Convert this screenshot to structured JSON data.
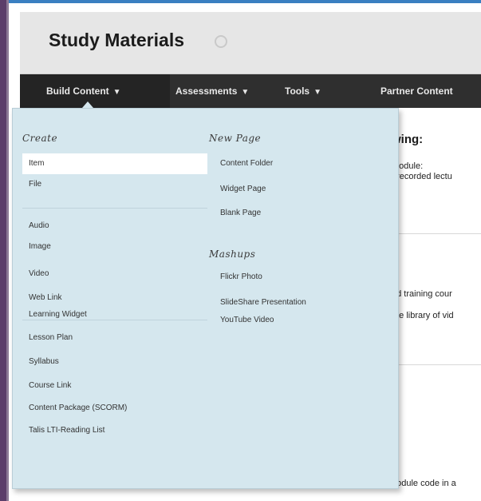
{
  "page": {
    "title": "Study Materials"
  },
  "menu": {
    "tabs": [
      {
        "label": "Build Content"
      },
      {
        "label": "Assessments"
      },
      {
        "label": "Tools"
      },
      {
        "label": "Partner Content"
      }
    ]
  },
  "background": {
    "heading": "wing:",
    "line1": "module:",
    "line2": ", recorded lectu",
    "line3": "ed training cour",
    "line4": "ete library of vid",
    "line5": "nodule code in a"
  },
  "dropdown": {
    "create": {
      "heading": "Create",
      "group1": [
        "Item",
        "File"
      ],
      "group2": [
        "Audio",
        "Image",
        "Video",
        "Web Link"
      ],
      "group3": [
        "Learning Widget",
        "Lesson Plan",
        "Syllabus",
        "Course Link",
        "Content Package (SCORM)",
        "Talis LTI-Reading List"
      ]
    },
    "new_page": {
      "heading": "New Page",
      "items": [
        "Content Folder",
        "Widget Page",
        "Blank Page"
      ]
    },
    "mashups": {
      "heading": "Mashups",
      "items": [
        "Flickr Photo",
        "SlideShare Presentation",
        "YouTube Video"
      ]
    }
  },
  "colors": {
    "menu_bar": "#2f2f2f",
    "dropdown_bg": "#d5e7ee",
    "title_band": "#e6e6e6"
  }
}
